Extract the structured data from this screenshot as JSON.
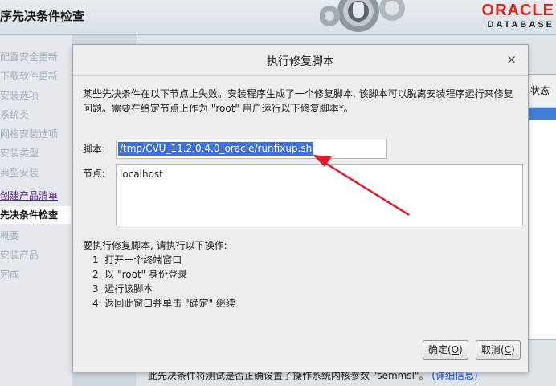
{
  "header": {
    "title": "序先决条件检查",
    "logo_word": "ORACLE",
    "logo_sub": "DATABASE",
    "brand_color": "#e2231a"
  },
  "sidebar": {
    "items": [
      {
        "label": "配置安全更新",
        "state": "disabled"
      },
      {
        "label": "下载软件更新",
        "state": "disabled"
      },
      {
        "label": "安装选项",
        "state": "disabled"
      },
      {
        "label": "系统类",
        "state": "disabled"
      },
      {
        "label": "网格安装选项",
        "state": "disabled"
      },
      {
        "label": "安装类型",
        "state": "disabled"
      },
      {
        "label": "典型安装",
        "state": "disabled"
      },
      {
        "label": "创建产品清单",
        "state": "link"
      },
      {
        "label": "先决条件检查",
        "state": "active"
      },
      {
        "label": "概要",
        "state": "disabled"
      },
      {
        "label": "安装产品",
        "state": "disabled"
      },
      {
        "label": "完成",
        "state": "disabled"
      }
    ]
  },
  "background": {
    "column_header": "状态",
    "footer_text": "此先决条件将测试是否正确设置了操作系统内核参数 \"semmsl\"。",
    "footer_link": "(详细信息)"
  },
  "dialog": {
    "title": "执行修复脚本",
    "close_glyph": "×",
    "message": "某些先决条件在以下节点上失败。安装程序生成了一个修复脚本, 该脚本可以脱离安装程序运行来修复问题。需要在给定节点上作为 \"root\" 用户运行以下修复脚本*。",
    "script_label": "脚本:",
    "script_path": "/tmp/CVU_11.2.0.4.0_oracle/runfixup.sh",
    "nodes_label": "节点:",
    "nodes_value": "localhost",
    "instructions_title": "要执行修复脚本, 请执行以下操作:",
    "steps": [
      "1. 打开一个终端窗口",
      "2. 以 \"root\" 身份登录",
      "3. 运行该脚本",
      "4. 返回此窗口并单击 \"确定\" 继续"
    ],
    "ok_label": "确定",
    "ok_key": "O",
    "cancel_label": "取消",
    "cancel_key": "C",
    "annotation_color": "#e8192c"
  }
}
